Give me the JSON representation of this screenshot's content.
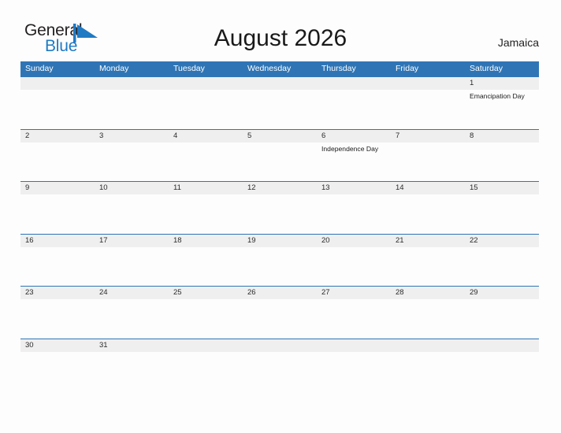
{
  "brand": {
    "name_part1": "General",
    "name_part2": "Blue",
    "mark": "triangle-flag-icon",
    "colors": {
      "blue": "#1f7ac4",
      "dark": "#231f20"
    }
  },
  "header": {
    "title": "August 2026",
    "region": "Jamaica"
  },
  "calendar": {
    "colors": {
      "header_blue": "#2f75b5",
      "date_band_gray": "#efefef",
      "row_rule": "#2f75b5"
    },
    "weekdays": [
      "Sunday",
      "Monday",
      "Tuesday",
      "Wednesday",
      "Thursday",
      "Friday",
      "Saturday"
    ],
    "weeks": [
      {
        "days": [
          {
            "date": "",
            "event": ""
          },
          {
            "date": "",
            "event": ""
          },
          {
            "date": "",
            "event": ""
          },
          {
            "date": "",
            "event": ""
          },
          {
            "date": "",
            "event": ""
          },
          {
            "date": "",
            "event": ""
          },
          {
            "date": "1",
            "event": "Emancipation Day"
          }
        ]
      },
      {
        "days": [
          {
            "date": "2",
            "event": ""
          },
          {
            "date": "3",
            "event": ""
          },
          {
            "date": "4",
            "event": ""
          },
          {
            "date": "5",
            "event": ""
          },
          {
            "date": "6",
            "event": "Independence Day"
          },
          {
            "date": "7",
            "event": ""
          },
          {
            "date": "8",
            "event": ""
          }
        ]
      },
      {
        "days": [
          {
            "date": "9",
            "event": ""
          },
          {
            "date": "10",
            "event": ""
          },
          {
            "date": "11",
            "event": ""
          },
          {
            "date": "12",
            "event": ""
          },
          {
            "date": "13",
            "event": ""
          },
          {
            "date": "14",
            "event": ""
          },
          {
            "date": "15",
            "event": ""
          }
        ]
      },
      {
        "days": [
          {
            "date": "16",
            "event": ""
          },
          {
            "date": "17",
            "event": ""
          },
          {
            "date": "18",
            "event": ""
          },
          {
            "date": "19",
            "event": ""
          },
          {
            "date": "20",
            "event": ""
          },
          {
            "date": "21",
            "event": ""
          },
          {
            "date": "22",
            "event": ""
          }
        ]
      },
      {
        "days": [
          {
            "date": "23",
            "event": ""
          },
          {
            "date": "24",
            "event": ""
          },
          {
            "date": "25",
            "event": ""
          },
          {
            "date": "26",
            "event": ""
          },
          {
            "date": "27",
            "event": ""
          },
          {
            "date": "28",
            "event": ""
          },
          {
            "date": "29",
            "event": ""
          }
        ]
      },
      {
        "days": [
          {
            "date": "30",
            "event": ""
          },
          {
            "date": "31",
            "event": ""
          },
          {
            "date": "",
            "event": ""
          },
          {
            "date": "",
            "event": ""
          },
          {
            "date": "",
            "event": ""
          },
          {
            "date": "",
            "event": ""
          },
          {
            "date": "",
            "event": ""
          }
        ]
      }
    ]
  }
}
